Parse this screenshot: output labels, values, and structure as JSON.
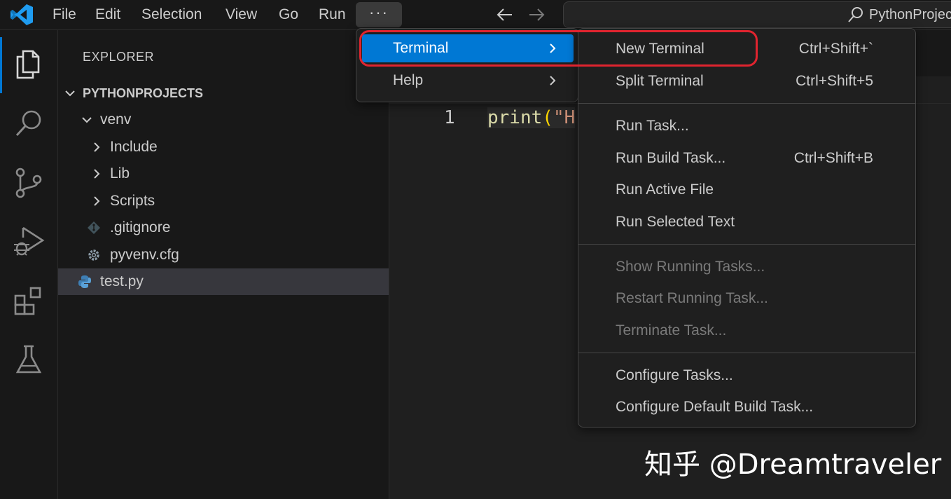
{
  "menubar": {
    "items": [
      "File",
      "Edit",
      "Selection",
      "View",
      "Go",
      "Run"
    ],
    "more_label": "···"
  },
  "search": {
    "text": "PythonProjec"
  },
  "activity_icons": [
    "explorer-icon",
    "search-icon",
    "source-control-icon",
    "run-debug-icon",
    "extensions-icon",
    "testing-icon"
  ],
  "explorer": {
    "title": "EXPLORER",
    "root": "PYTHONPROJECTS",
    "tree": {
      "venv": "venv",
      "include": "Include",
      "lib": "Lib",
      "scripts": "Scripts",
      "gitignore": ".gitignore",
      "pyvenv": "pyvenv.cfg",
      "test": "test.py"
    }
  },
  "editor": {
    "line_number": "1",
    "code_fn": "print",
    "code_paren": "(",
    "code_str": "\"H"
  },
  "overflow_menu": {
    "terminal": "Terminal",
    "help": "Help"
  },
  "terminal_menu": {
    "new_terminal": {
      "label": "New Terminal",
      "shortcut": "Ctrl+Shift+`"
    },
    "split_terminal": {
      "label": "Split Terminal",
      "shortcut": "Ctrl+Shift+5"
    },
    "run_task": {
      "label": "Run Task..."
    },
    "run_build_task": {
      "label": "Run Build Task...",
      "shortcut": "Ctrl+Shift+B"
    },
    "run_active_file": {
      "label": "Run Active File"
    },
    "run_selected_text": {
      "label": "Run Selected Text"
    },
    "show_running_tasks": {
      "label": "Show Running Tasks..."
    },
    "restart_running_task": {
      "label": "Restart Running Task..."
    },
    "terminate_task": {
      "label": "Terminate Task..."
    },
    "configure_tasks": {
      "label": "Configure Tasks..."
    },
    "configure_default_build_task": {
      "label": "Configure Default Build Task..."
    }
  },
  "watermark": "知乎 @Dreamtraveler",
  "colors": {
    "accent": "#0078d4",
    "highlight_box": "#e0242f",
    "background": "#1f1f1f"
  }
}
